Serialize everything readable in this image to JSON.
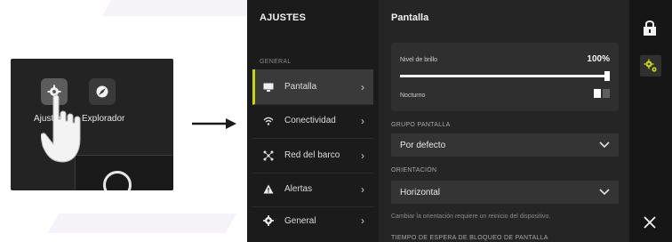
{
  "home": {
    "apps": [
      {
        "label": "Ajustes",
        "icon": "gear-icon"
      },
      {
        "label": "Explorador",
        "icon": "compass-icon"
      }
    ],
    "tile_icon": "compass-icon",
    "gesture_icon": "pointing-hand-icon"
  },
  "arrow_icon": "right-arrow-icon",
  "sidebar": {
    "title": "AJUSTES",
    "section": "GENERAL",
    "items": [
      {
        "label": "Pantalla",
        "icon": "display-icon",
        "active": true
      },
      {
        "label": "Conectividad",
        "icon": "wifi-icon",
        "active": false
      },
      {
        "label": "Red del barco",
        "icon": "network-icon",
        "active": false
      },
      {
        "label": "Alertas",
        "icon": "warning-icon",
        "active": false
      },
      {
        "label": "General",
        "icon": "gear-icon",
        "active": false
      }
    ],
    "chevron": "›"
  },
  "main": {
    "title": "Pantalla",
    "brightness": {
      "label": "Nivel de brillo",
      "value": "100%",
      "level": 1.0
    },
    "night": {
      "label": "Nocturno",
      "on": false
    },
    "group_label": "GRUPO PANTALLA",
    "group_value": "Por defecto",
    "orientation_label": "ORIENTACIÓN",
    "orientation_value": "Horizontal",
    "hint": "Cambiar la orientación requiere un reinicio del dispositivo.",
    "timeout_label": "TIEMPO DE ESPERA DE BLOQUEO DE PANTALLA"
  },
  "rail": {
    "icons": [
      "lock-icon",
      "settings-icon",
      "close-icon"
    ]
  },
  "colors": {
    "accent": "#c6d900",
    "panel": "#252525",
    "sidebar": "#1b1b1b"
  }
}
